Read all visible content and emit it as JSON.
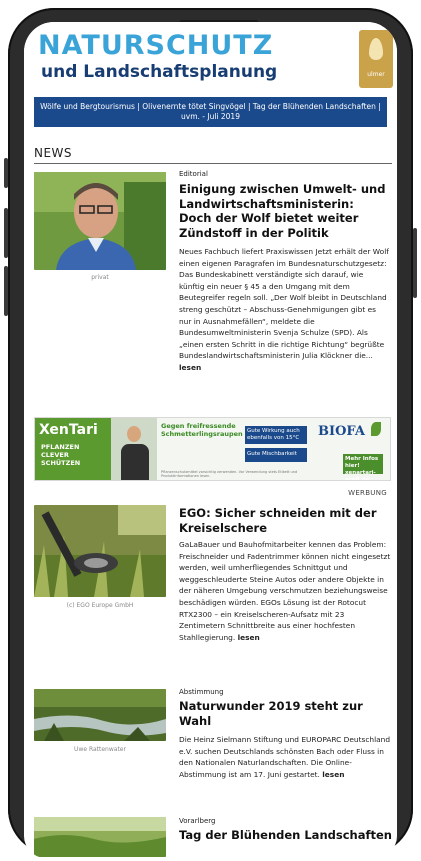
{
  "masthead": {
    "title": "NATURSCHUTZ",
    "subtitle": "und Landschaftsplanung",
    "logo_text": "ulmer"
  },
  "topics_bar": "Wölfe und Bergtourismus | Olivenernte tötet Singvögel | Tag der Blühenden Landschaften | uvm. - Juli 2019",
  "section_title": "NEWS",
  "articles": [
    {
      "kicker": "Editorial",
      "title": "Einigung zwischen Umwelt- und Landwirtschaftsministerin: Doch der Wolf bietet weiter Zündstoff in der Politik",
      "body": "Neues Fachbuch liefert Praxiswissen Jetzt erhält der Wolf einen eigenen Paragrafen im Bundesnaturschutzgesetz: Das Bundeskabinett verständigte sich darauf, wie künftig ein neuer § 45 a den Umgang mit dem Beutegreifer regeln soll. „Der Wolf bleibt in Deutschland streng geschützt – Abschuss-Genehmigungen gibt es nur in Ausnahmefällen“, meldete die Bundesumweltministerin Svenja Schulze (SPD). Als „einen ersten Schritt in die richtige Richtung“ begrüßte Bundeslandwirtschaftsministerin Julia Klöckner die...",
      "more": "lesen",
      "caption": "privat"
    },
    {
      "kicker": "",
      "title": "EGO: Sicher schneiden mit der Kreiselschere",
      "body": "GaLaBauer und Bauhofmitarbeiter kennen das Problem: Freischneider und Fadentrimmer können nicht eingesetzt werden, weil umherfliegendes Schnittgut und weggeschleuderte Steine Autos oder andere Objekte in der näheren Umgebung verschmutzen beziehungsweise beschädigen würden. EGOs Lösung ist der Rotocut RTX2300 – ein Kreiselscheren-Aufsatz mit 23 Zentimetern Schnittbreite aus einer hochfesten Stahllegierung.",
      "more": "lesen",
      "caption": "(c) EGO Europe GmbH"
    },
    {
      "kicker": "Abstimmung",
      "title": "Naturwunder 2019 steht zur Wahl",
      "body": "Die Heinz Sielmann Stiftung und EUROPARC Deutschland e.V. suchen Deutschlands schönsten Bach oder Fluss in den Nationalen Naturlandschaften. Die Online-Abstimmung ist am 17. Juni gestartet.",
      "more": "lesen",
      "caption": "Uwe Rattenwater"
    },
    {
      "kicker": "Vorarlberg",
      "title": "Tag der Blühenden Landschaften"
    }
  ],
  "sponsored_label": "WERBUNG",
  "ad": {
    "brand": "XenTari",
    "tagline": "PFLANZEN CLEVER SCHÜTZEN",
    "claim": "Gegen freifressende Schmetterlingsraupen",
    "box1": "Gute Wirkung auch ebenfalls von 15°C",
    "box2": "Gute Mischbarkeit",
    "fine_print": "Pflanzenschutzmittel vorsichtig verwenden. Vor Verwendung stets Etikett und Produktinformationen lesen.",
    "partner": "BIOFA",
    "more": "Mehr Infos hier! xenartari-profi.de"
  },
  "colors": {
    "masthead_title": "#3aa3d8",
    "masthead_sub": "#173d72",
    "topics_bar_bg": "#1b4a8c",
    "ad_green": "#5a9a2e"
  }
}
